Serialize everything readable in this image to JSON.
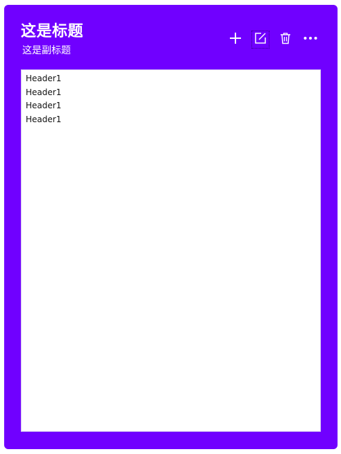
{
  "card": {
    "title": "这是标题",
    "subtitle": "这是副标题",
    "accent_color": "#7000ff"
  },
  "toolbar": {
    "buttons": [
      {
        "icon": "plus-icon",
        "label": "add"
      },
      {
        "icon": "edit-icon",
        "label": "edit"
      },
      {
        "icon": "trash-icon",
        "label": "delete"
      },
      {
        "icon": "more-icon",
        "label": "more"
      }
    ]
  },
  "list": {
    "items": [
      {
        "label": "Header1"
      },
      {
        "label": "Header1"
      },
      {
        "label": "Header1"
      },
      {
        "label": "Header1"
      }
    ]
  }
}
